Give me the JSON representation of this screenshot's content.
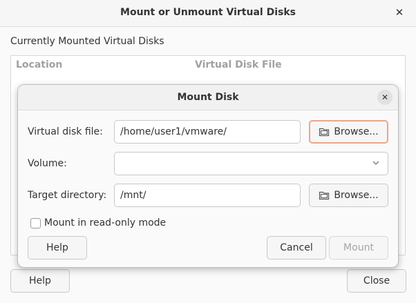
{
  "outer_window": {
    "title": "Mount or Unmount Virtual Disks",
    "section_label": "Currently Mounted Virtual Disks",
    "columns": [
      "Location",
      "Virtual Disk File"
    ],
    "help_label": "Help",
    "close_label": "Close"
  },
  "mount_dialog": {
    "title": "Mount Disk",
    "virtual_disk_file": {
      "label": "Virtual disk file:",
      "value": "/home/user1/vmware/",
      "browse_label": "Browse..."
    },
    "volume": {
      "label": "Volume:",
      "value": ""
    },
    "target_directory": {
      "label": "Target directory:",
      "value": "/mnt/",
      "browse_label": "Browse..."
    },
    "read_only": {
      "label": "Mount in read-only mode",
      "checked": false
    },
    "help_label": "Help",
    "cancel_label": "Cancel",
    "mount_label": "Mount"
  },
  "icons": {
    "close": "close-icon",
    "folder": "folder-icon",
    "dropdown": "chevron-down-icon"
  },
  "colors": {
    "focus_ring": "#e9a788",
    "disabled_text": "#a5a5a5"
  }
}
